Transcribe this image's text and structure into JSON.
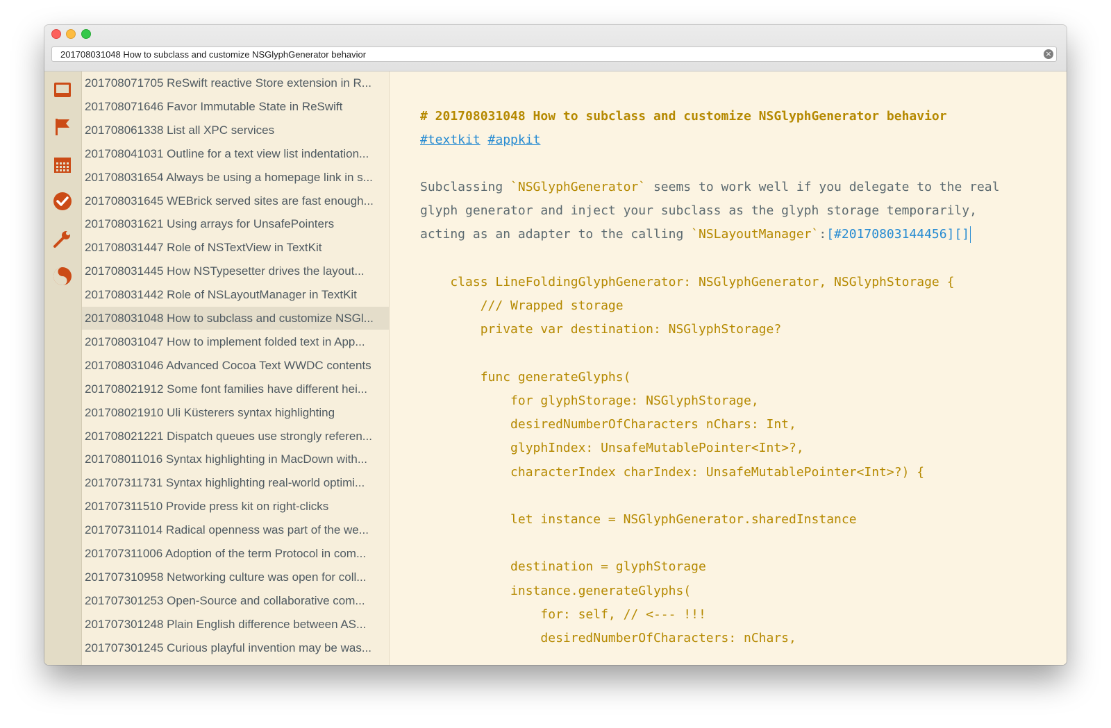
{
  "search": {
    "value": "201708031048 How to subclass and customize NSGlyphGenerator behavior",
    "clear_icon": "circle-x-icon"
  },
  "sidebar": {
    "icons": [
      "tray-icon",
      "flag-icon",
      "calendar-icon",
      "checkmark-icon",
      "wrench-icon",
      "yin-yang-icon"
    ],
    "accent_color": "#cb4b16"
  },
  "notes": {
    "selected_index": 10,
    "items": [
      {
        "label": "201708071705 ReSwift reactive Store extension in R..."
      },
      {
        "label": "201708071646 Favor Immutable State in ReSwift"
      },
      {
        "label": "201708061338 List all XPC services"
      },
      {
        "label": "201708041031 Outline for a text view list indentation..."
      },
      {
        "label": "201708031654 Always be using a homepage link in s..."
      },
      {
        "label": "201708031645 WEBrick served sites are fast enough..."
      },
      {
        "label": "201708031621 Using arrays for UnsafePointers"
      },
      {
        "label": "201708031447 Role of NSTextView in TextKit"
      },
      {
        "label": "201708031445 How NSTypesetter drives the layout..."
      },
      {
        "label": "201708031442 Role of NSLayoutManager in TextKit"
      },
      {
        "label": "201708031048 How to subclass and customize NSGl..."
      },
      {
        "label": "201708031047 How to implement folded text in App..."
      },
      {
        "label": "201708031046 Advanced Cocoa Text WWDC contents"
      },
      {
        "label": "201708021912 Some font families have different hei..."
      },
      {
        "label": "201708021910 Uli Küsterers syntax highlighting"
      },
      {
        "label": "201708021221 Dispatch queues use strongly referen..."
      },
      {
        "label": "201708011016 Syntax highlighting in MacDown with..."
      },
      {
        "label": "201707311731 Syntax highlighting real-world optimi..."
      },
      {
        "label": "201707311510 Provide press kit on right-clicks"
      },
      {
        "label": "201707311014 Radical openness was part of the we..."
      },
      {
        "label": "201707311006 Adoption of the term Protocol in com..."
      },
      {
        "label": "201707310958 Networking culture was open for coll..."
      },
      {
        "label": "201707301253 Open-Source and collaborative com..."
      },
      {
        "label": "201707301248 Plain English difference between AS..."
      },
      {
        "label": "201707301245 Curious playful invention may be was..."
      }
    ]
  },
  "editor": {
    "heading": "# 201708031048 How to subclass and customize NSGlyphGenerator behavior",
    "tag_1": "#textkit",
    "tag_2": "#appkit",
    "para_line_1_a": "Subclassing ",
    "para_line_1_code": "`NSGlyphGenerator`",
    "para_line_1_b": " seems to work well if you delegate to the real",
    "para_line_2": "glyph generator and inject your subclass as the glyph storage temporarily,",
    "para_line_3_a": "acting as an adapter to the calling ",
    "para_line_3_code": "`NSLayoutManager`",
    "para_line_3_b": ":",
    "para_line_3_link": "[#20170803144456][]",
    "code_lines": [
      "    class LineFoldingGlyphGenerator: NSGlyphGenerator, NSGlyphStorage {",
      "        /// Wrapped storage",
      "        private var destination: NSGlyphStorage?",
      "",
      "        func generateGlyphs(",
      "            for glyphStorage: NSGlyphStorage,",
      "            desiredNumberOfCharacters nChars: Int,",
      "            glyphIndex: UnsafeMutablePointer<Int>?,",
      "            characterIndex charIndex: UnsafeMutablePointer<Int>?) {",
      "",
      "            let instance = NSGlyphGenerator.sharedInstance",
      "",
      "            destination = glyphStorage",
      "            instance.generateGlyphs(",
      "                for: self, // <--- !!!",
      "                desiredNumberOfCharacters: nChars,"
    ]
  }
}
